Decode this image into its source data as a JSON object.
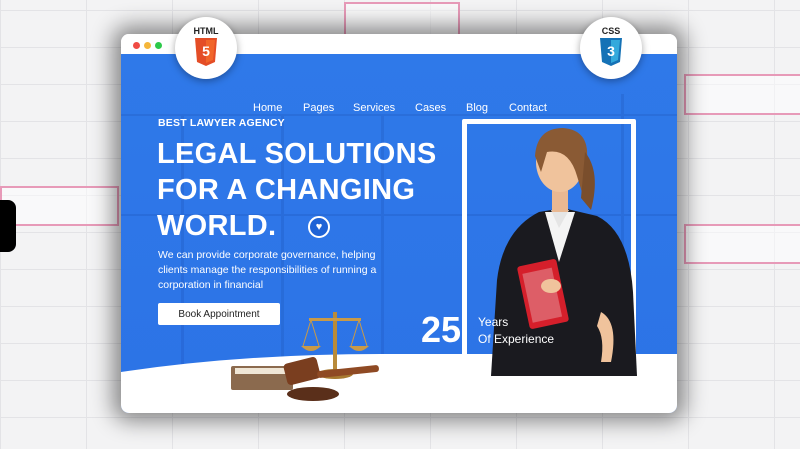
{
  "browser": {
    "dots": [
      "#f04b44",
      "#f5b63a",
      "#2dc94a"
    ]
  },
  "badges": {
    "html_label": "HTML",
    "html_number": "5",
    "css_label": "CSS",
    "css_number": "3"
  },
  "nav": {
    "items": [
      "Home",
      "Pages",
      "Services",
      "Cases",
      "Blog",
      "Contact"
    ]
  },
  "hero": {
    "eyebrow": "BEST LAWYER AGENCY",
    "headline_lines": [
      "LEGAL SOLUTIONS",
      "FOR A CHANGING",
      "WORLD."
    ],
    "description": "We can provide corporate governance, helping clients manage the responsibilities of running a corporation in financial",
    "cta": "Book Appointment",
    "years_number": "25",
    "years_line1": "Years",
    "years_line2": "Of Experience"
  },
  "icons": {
    "heart": "heart-icon",
    "scale": "justice-scale-icon",
    "gavel": "gavel-icon",
    "book": "book-icon"
  },
  "colors": {
    "hero_blue": "#2f79e9",
    "html_orange": "#e44d26",
    "css_blue": "#1572b6",
    "accent_pink": "#e79ab8"
  }
}
